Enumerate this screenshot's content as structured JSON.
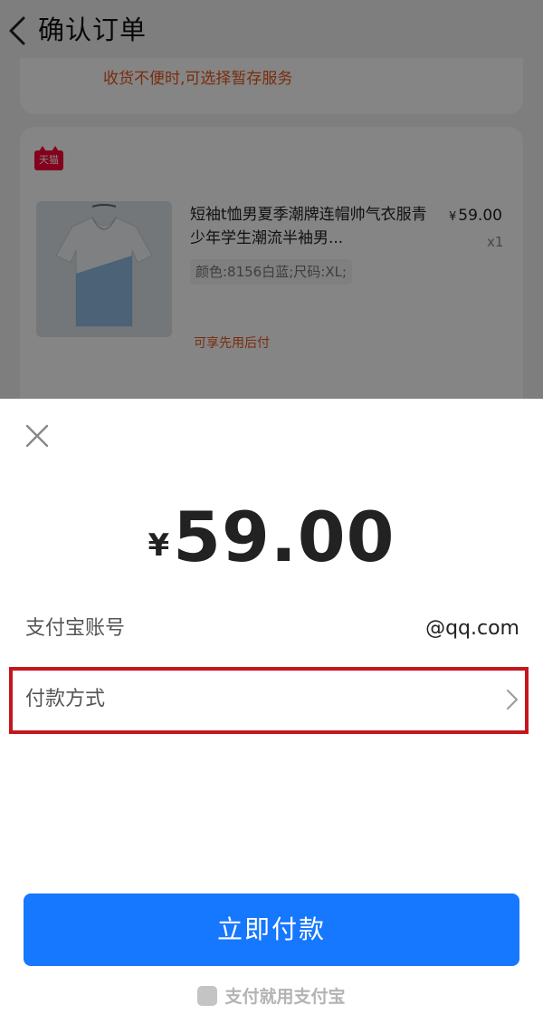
{
  "background_page": {
    "nav": {
      "back_icon": "chevron-left-icon",
      "title": "确认订单"
    },
    "storage_tip": "收货不便时,可选择暂存服务",
    "store_badge": "天猫",
    "product": {
      "title": "短袖t恤男夏季潮牌连帽帅气衣服青少年学生潮流半袖男...",
      "price_symbol": "¥",
      "price": "59.00",
      "quantity": "x1",
      "spec": "颜色:8156白蓝;尺码:XL;",
      "tag": "可享先用后付"
    }
  },
  "payment_sheet": {
    "close_icon": "close-icon",
    "amount_symbol": "¥",
    "amount": "59.00",
    "account_label": "支付宝账号",
    "account_value": "@qq.com",
    "method_label": "付款方式",
    "method_chevron_icon": "chevron-right-icon",
    "pay_button": "立即付款",
    "footer_text": "支付就用支付宝"
  },
  "colors": {
    "primary_blue": "#1677ff",
    "highlight_red": "#c5161d",
    "tip_orange": "#e8551a",
    "tmall_red": "#ff0036"
  }
}
